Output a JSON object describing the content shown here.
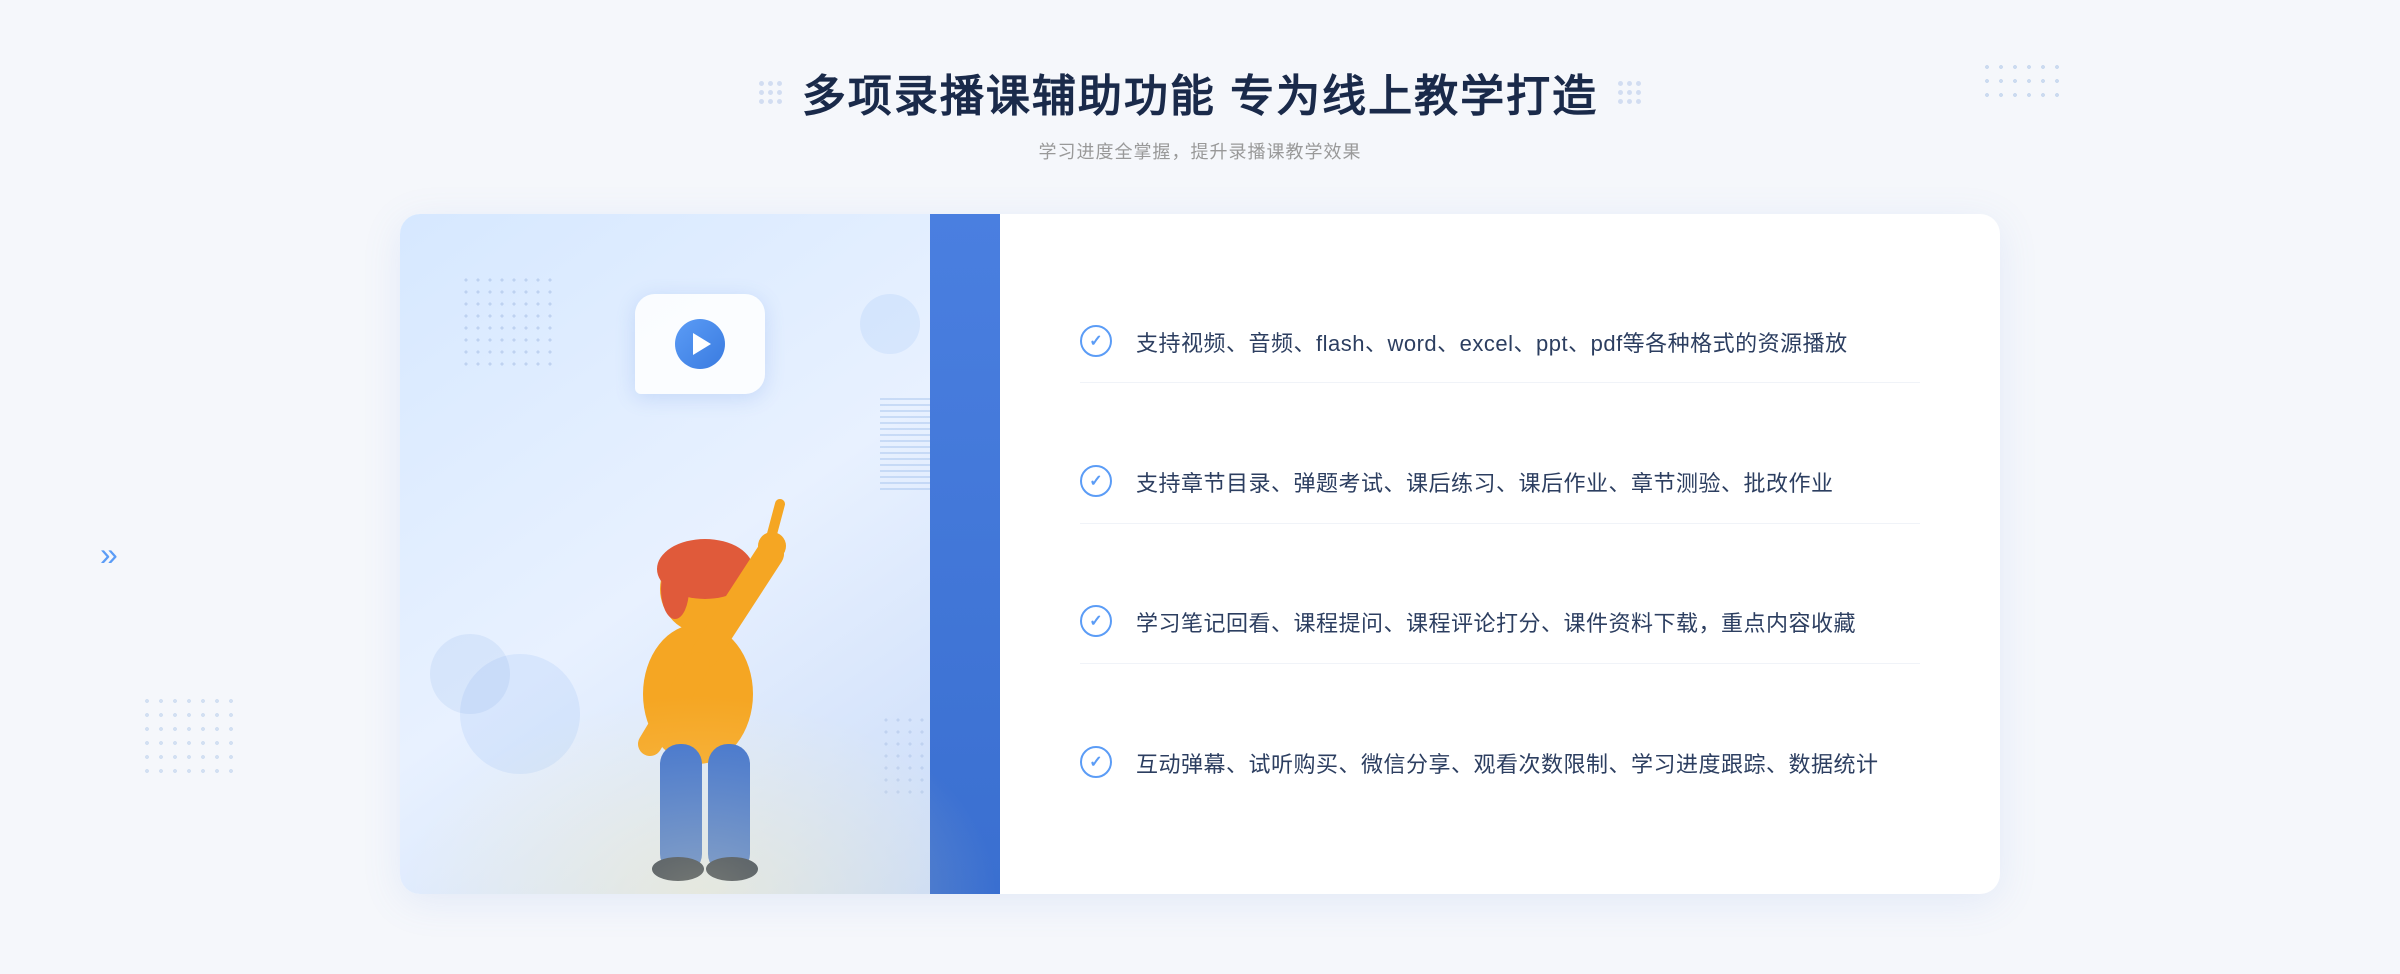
{
  "header": {
    "main_title": "多项录播课辅助功能 专为线上教学打造",
    "sub_title": "学习进度全掌握，提升录播课教学效果"
  },
  "features": [
    {
      "id": "feature-1",
      "text": "支持视频、音频、flash、word、excel、ppt、pdf等各种格式的资源播放"
    },
    {
      "id": "feature-2",
      "text": "支持章节目录、弹题考试、课后练习、课后作业、章节测验、批改作业"
    },
    {
      "id": "feature-3",
      "text": "学习笔记回看、课程提问、课程评论打分、课件资料下载，重点内容收藏"
    },
    {
      "id": "feature-4",
      "text": "互动弹幕、试听购买、微信分享、观看次数限制、学习进度跟踪、数据统计"
    }
  ],
  "decorations": {
    "chevron": "»"
  }
}
